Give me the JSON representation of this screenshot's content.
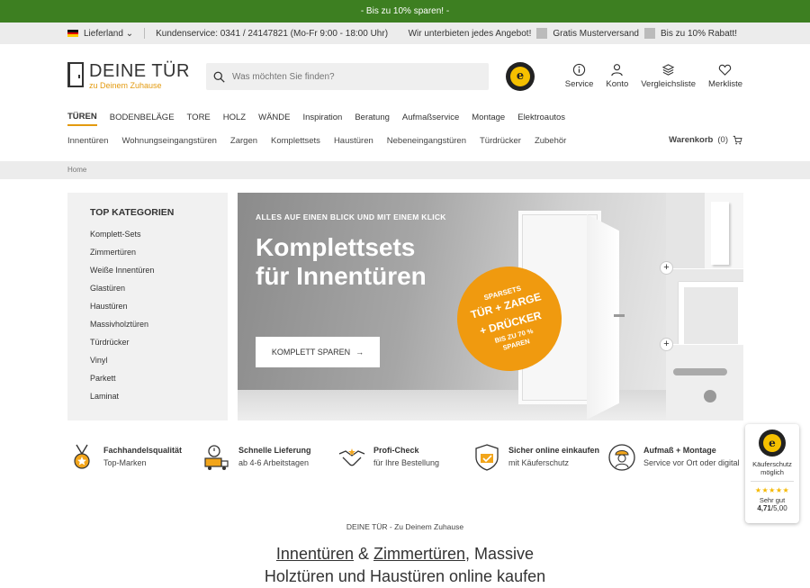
{
  "promo": {
    "text": "- Bis zu 10% sparen! -"
  },
  "infobar": {
    "country_label": "Lieferland",
    "service": "Kundenservice: 0341 / 24147821 (Mo-Fr 9:00 - 18:00 Uhr)",
    "claims": [
      "Wir unterbieten jedes Angebot!",
      "Gratis Musterversand",
      "Bis zu 10% Rabatt!"
    ]
  },
  "logo": {
    "title": "DEINE TÜR",
    "subtitle": "zu Deinem Zuhause"
  },
  "search": {
    "placeholder": "Was möchten Sie finden?"
  },
  "header_icons": [
    {
      "label": "Service",
      "icon": "info-icon"
    },
    {
      "label": "Konto",
      "icon": "user-icon"
    },
    {
      "label": "Vergleichsliste",
      "icon": "layers-icon"
    },
    {
      "label": "Merkliste",
      "icon": "heart-icon"
    }
  ],
  "main_nav": [
    "TÜREN",
    "BODENBELÄGE",
    "TORE",
    "HOLZ",
    "WÄNDE",
    "Inspiration",
    "Beratung",
    "Aufmaßservice",
    "Montage",
    "Elektroautos"
  ],
  "sub_nav": [
    "Innentüren",
    "Wohnungseingangstüren",
    "Zargen",
    "Komplettsets",
    "Haustüren",
    "Nebeneingangstüren",
    "Türdrücker",
    "Zubehör"
  ],
  "cart": {
    "label": "Warenkorb",
    "count": "(0)"
  },
  "breadcrumb": {
    "home": "Home"
  },
  "categories": {
    "title": "TOP KATEGORIEN",
    "items": [
      "Komplett-Sets",
      "Zimmertüren",
      "Weiße Innentüren",
      "Glastüren",
      "Haustüren",
      "Massivholztüren",
      "Türdrücker",
      "Vinyl",
      "Parkett",
      "Laminat"
    ]
  },
  "hero": {
    "tagline": "ALLES AUF EINEN BLICK UND MIT EINEM KLICK",
    "headline_1": "Komplettsets",
    "headline_2": "für Innentüren",
    "cta": "KOMPLETT SPAREN",
    "sticker_1": "SPARSETS",
    "sticker_2": "TÜR + ZARGE",
    "sticker_3": "+ DRÜCKER",
    "sticker_4": "BIS ZU 70 %",
    "sticker_5": "SPAREN"
  },
  "usps": [
    {
      "title": "Fachhandelsqualität",
      "desc": "Top-Marken"
    },
    {
      "title": "Schnelle Lieferung",
      "desc": "ab 4-6 Arbeitstagen"
    },
    {
      "title": "Profi-Check",
      "desc": "für Ihre Bestellung"
    },
    {
      "title": "Sicher online einkaufen",
      "desc": "mit Käuferschutz"
    },
    {
      "title": "Aufmaß + Montage",
      "desc": "Service vor Ort oder digital"
    }
  ],
  "trust": {
    "line1": "Käuferschutz",
    "line2": "möglich",
    "stars": "★★★★★",
    "rating_label": "Sehr gut",
    "score": "4,71",
    "scale": "/5,00"
  },
  "footer": {
    "subtitle": "DEINE TÜR - Zu Deinem Zuhause",
    "heading_link1": "Innentüren",
    "heading_amp": " & ",
    "heading_link2": "Zimmertüren",
    "heading_rest": ", Massive",
    "heading_line2": "Holztüren und Haustüren online kaufen"
  },
  "colors": {
    "promo_bg": "#3d7f21",
    "accent": "#e39a0f",
    "sticker": "#f09a0f"
  }
}
